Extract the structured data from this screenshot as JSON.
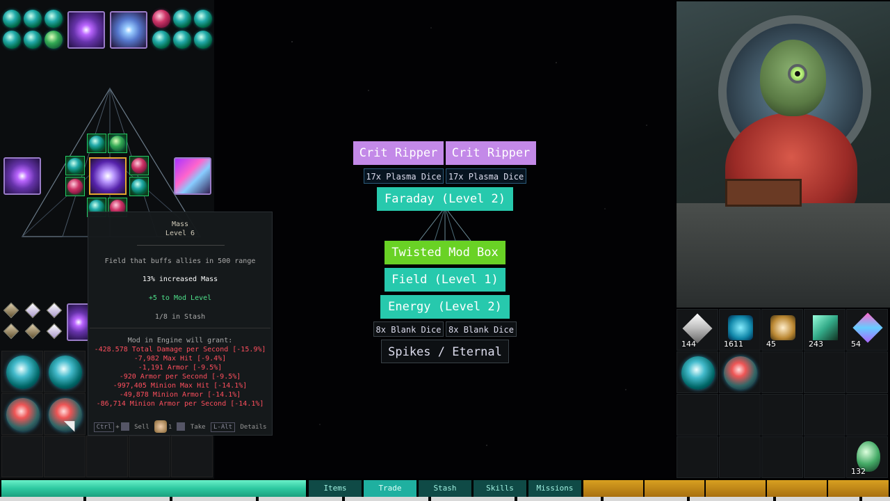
{
  "tooltip": {
    "title": "Mass",
    "level": "Level 6",
    "description": "Field that buffs allies in 500 range",
    "stat": "13% increased Mass",
    "bonus": "+5 to Mod Level",
    "stash": "1/8 in Stash",
    "grant_header": "Mod in Engine will grant:",
    "grants": [
      "-428.578 Total Damage per Second [-15.9%]",
      "-7,982 Max Hit [-9.4%]",
      "-1,191 Armor [-9.5%]",
      "-920 Armor per Second [-9.5%]",
      "-997,405 Minion Max Hit [-14.1%]",
      "-49,878 Minion Armor [-14.1%]",
      "-86,714 Minion Armor per Second [-14.1%]"
    ],
    "controls": {
      "ctrl_key": "Ctrl",
      "plus": "+",
      "sell": "Sell",
      "dice_count": "1",
      "take": "Take",
      "lalt_key": "L-Alt",
      "details": "Details"
    }
  },
  "center": {
    "crit_ripper_1": "Crit Ripper",
    "crit_ripper_2": "Crit Ripper",
    "plasma_dice_1": "17x Plasma Dice",
    "plasma_dice_2": "17x Plasma Dice",
    "faraday": "Faraday (Level 2)",
    "twisted_mod_box": "Twisted Mod Box",
    "field": "Field (Level 1)",
    "energy": "Energy (Level 2)",
    "blank_dice_1": "8x Blank Dice",
    "blank_dice_2": "8x Blank Dice",
    "spikes_eternal": "Spikes / Eternal"
  },
  "inventory": {
    "counts": [
      "144",
      "1611",
      "45",
      "243",
      "54"
    ],
    "egg_count": "132"
  },
  "nav": {
    "tabs": [
      "Items",
      "Trade",
      "Stash",
      "Skills",
      "Missions"
    ],
    "active": "Trade"
  },
  "colors": {
    "lavender": "#c389e8",
    "teal": "#27c9ad",
    "lime": "#69d225",
    "tooltip_red": "#ff4f5e",
    "tooltip_green": "#4ee08a"
  }
}
